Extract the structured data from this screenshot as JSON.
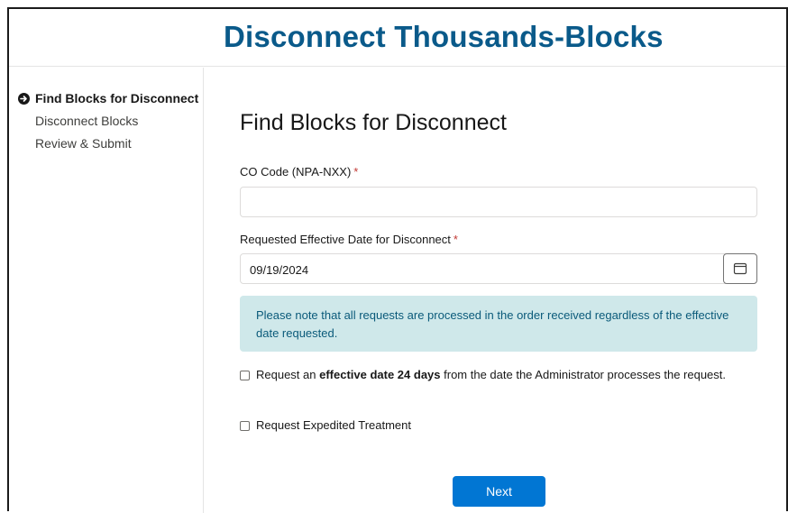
{
  "header": {
    "title": "Disconnect Thousands-Blocks"
  },
  "sidebar": {
    "steps": [
      {
        "label": "Find Blocks for Disconnect",
        "current": true
      },
      {
        "label": "Disconnect Blocks",
        "current": false
      },
      {
        "label": "Review & Submit",
        "current": false
      }
    ]
  },
  "main": {
    "section_title": "Find Blocks for Disconnect",
    "co_code": {
      "label": "CO Code (NPA-NXX)",
      "required_mark": "*",
      "value": ""
    },
    "effective_date": {
      "label": "Requested Effective Date for Disconnect",
      "required_mark": "*",
      "value": "09/19/2024"
    },
    "notice": "Please note that all requests are processed in the order received regardless of the effective date requested.",
    "options": [
      {
        "prefix": "Request an ",
        "bold": "effective date 24 days",
        "suffix": " from the date the Administrator processes the request.",
        "checked": false
      },
      {
        "prefix": "Request Expedited Treatment",
        "bold": "",
        "suffix": "",
        "checked": false
      }
    ],
    "next_label": "Next"
  },
  "icons": [
    "arrow-circle-right-icon",
    "calendar-icon"
  ],
  "colors": {
    "title": "#0a5a8a",
    "primary_button": "#0176d3",
    "notice_bg": "#cfe8ea",
    "required": "#c23934"
  }
}
